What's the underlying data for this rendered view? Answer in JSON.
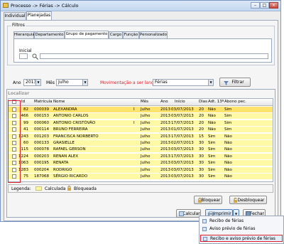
{
  "window": {
    "title": "Processo -> Férias -> Cálculo",
    "min": "–",
    "max": "□",
    "close": "×"
  },
  "tabs": [
    "Individual",
    "Planejadas"
  ],
  "filters": {
    "title": "Filtros",
    "tabs": [
      "Hierarquia",
      "Departamento",
      "Grupo de pagamento",
      "Cargo",
      "Função",
      "Personalizado"
    ],
    "inicial_label": "Inicial"
  },
  "period": {
    "ano_label": "Ano",
    "ano_value": "2013",
    "mes_label": "Mês",
    "mes_value": "Julho",
    "mov_label": "Movimentação a ser lançada",
    "mov_value": "Férias",
    "filtrar_label": "Filtrar"
  },
  "localizar_label": "Localizar",
  "table": {
    "columns": [
      "Id",
      "Matrícula",
      "Nome",
      "Mês",
      "Ano",
      "Início",
      "Dias",
      "Adt. 13º",
      "Abono pec."
    ],
    "rows": [
      {
        "id": "82",
        "matricula": "000039",
        "nome": "ALEXANDRA",
        "mark": "I",
        "mes": "Julho",
        "ano": "2013",
        "inicio": "03/07/2013",
        "dias": "20",
        "adt": "Não",
        "abono": "Sim"
      },
      {
        "id": "466",
        "matricula": "000153",
        "nome": "ANTONIO CARLOS",
        "mark": "",
        "mes": "Julho",
        "ano": "2013",
        "inicio": "03/07/2013",
        "dias": "20",
        "adt": "Não",
        "abono": "Sim"
      },
      {
        "id": "99",
        "matricula": "000060",
        "nome": "ANTONIO CRISTÓVÃO",
        "mark": "I",
        "mes": "Julho",
        "ano": "2013",
        "inicio": "17/07/2013",
        "dias": "20",
        "adt": "Não",
        "abono": "Sim"
      },
      {
        "id": "41",
        "matricula": "000114",
        "nome": "BRUNO FERREIRA",
        "mark": "",
        "mes": "Julho",
        "ano": "2013",
        "inicio": "01/07/2013",
        "dias": "20",
        "adt": "Não",
        "abono": "Sim"
      },
      {
        "id": "1243",
        "matricula": "001203",
        "nome": "FRANCISCA NORBERTO",
        "mark": "",
        "mes": "Julho",
        "ano": "2013",
        "inicio": "17/07/2013",
        "dias": "15",
        "adt": "Sim",
        "abono": "Não"
      },
      {
        "id": "60",
        "matricula": "000133",
        "nome": "GRASIELLE",
        "mark": "",
        "mes": "Julho",
        "ano": "2013",
        "inicio": "02/07/2013",
        "dias": "30",
        "adt": "Sim",
        "abono": "Não"
      },
      {
        "id": "115",
        "matricula": "000078",
        "nome": "RAFAEL GERSON",
        "mark": "",
        "mes": "Julho",
        "ano": "2013",
        "inicio": "03/07/2013",
        "dias": "30",
        "adt": "Sim",
        "abono": "Não"
      },
      {
        "id": "1224",
        "matricula": "000203",
        "nome": "RENAN ALEX",
        "mark": "",
        "mes": "Julho",
        "ano": "2013",
        "inicio": "17/07/2013",
        "dias": "30",
        "adt": "Sim",
        "abono": "Não"
      },
      {
        "id": "1063",
        "matricula": "000195",
        "nome": "RENATA",
        "mark": "",
        "mes": "Julho",
        "ano": "2013",
        "inicio": "03/07/2013",
        "dias": "30",
        "adt": "Sim",
        "abono": "Não"
      },
      {
        "id": "1283",
        "matricula": "000204",
        "nome": "RODRIGO",
        "mark": "",
        "mes": "Julho",
        "ano": "2013",
        "inicio": "03/07/2013",
        "dias": "30",
        "adt": "Sim",
        "abono": "Não"
      },
      {
        "id": "75",
        "matricula": "187068",
        "nome": "SÉRGIO RICARDO",
        "mark": "",
        "mes": "Julho",
        "ano": "2013",
        "inicio": "03/07/2013",
        "dias": "30",
        "adt": "Sim",
        "abono": "Não"
      }
    ]
  },
  "legend": {
    "label": "Legenda:",
    "calc": "Calculada",
    "block": "Bloqueada"
  },
  "buttons": {
    "bloquear": "Bloquear",
    "desbloquear": "Desbloquear",
    "calcular": "Calcular",
    "imprimir": "Imprimir",
    "fechar": "Fechar"
  },
  "print_menu": [
    "Recibo de férias",
    "Aviso prévio de férias",
    "Recibo e aviso prévio de férias"
  ],
  "colors": {
    "row": "#fff9a6",
    "row_selected": "#ffe36a",
    "highlight": "#e0202a",
    "accent": "#7a96c4"
  }
}
